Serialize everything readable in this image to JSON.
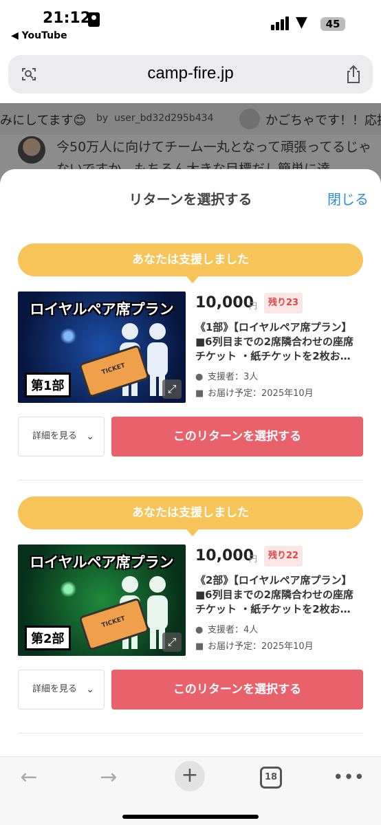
{
  "status_bar": {
    "time": "21:12",
    "back_app": "◀ YouTube",
    "battery": "45"
  },
  "url_bar": {
    "url": "camp-fire.jp"
  },
  "background_page": {
    "ticker_text_1": "みにしてます😊",
    "ticker_by": "by",
    "ticker_user": "user_bd32d295b434",
    "ticker_text_2": "かごちゃです！！応援",
    "comment_text": "今50万人に向けてチーム一丸となって頑張ってるじゃないですか。もちろん大きな目標だし簡単に達"
  },
  "sheet": {
    "title": "リターンを選択する",
    "close_label": "閉じる"
  },
  "returns": [
    {
      "supported_label": "あなたは支援しました",
      "thumb_title": "ロイヤルペア席プラン",
      "thumb_part": "第1部",
      "thumb_ticket": "TICKET",
      "price": "10,000",
      "currency": "円",
      "remaining": "残り23",
      "desc_line_1": "《1部》【ロイヤルペア席プラン】",
      "desc_line_2": "■6列目までの2席隣合わせの座席",
      "desc_line_3": "チケット ・紙チケットを2枚お…",
      "supporters": "支援者：3人",
      "delivery": "お届け予定：2025年10月",
      "detail_label": "詳細を見る",
      "select_label": "このリターンを選択する",
      "theme": "blue"
    },
    {
      "supported_label": "あなたは支援しました",
      "thumb_title": "ロイヤルペア席プラン",
      "thumb_part": "第2部",
      "thumb_ticket": "TICKET",
      "price": "10,000",
      "currency": "円",
      "remaining": "残り22",
      "desc_line_1": "《2部》【ロイヤルペア席プラン】",
      "desc_line_2": "■6列目までの2席隣合わせの座席",
      "desc_line_3": "チケット ・紙チケットを2枚お…",
      "supporters": "支援者：4人",
      "delivery": "お届け予定：2025年10月",
      "detail_label": "詳細を見る",
      "select_label": "このリターンを選択する",
      "theme": "green"
    }
  ],
  "toolbar": {
    "tab_count": "18"
  },
  "colors": {
    "bubble": "#f6c459",
    "select_button": "#e9626b",
    "close_link": "#2f8bd6",
    "remaining_badge_bg": "#fbe6e6",
    "remaining_badge_text": "#e04545"
  }
}
